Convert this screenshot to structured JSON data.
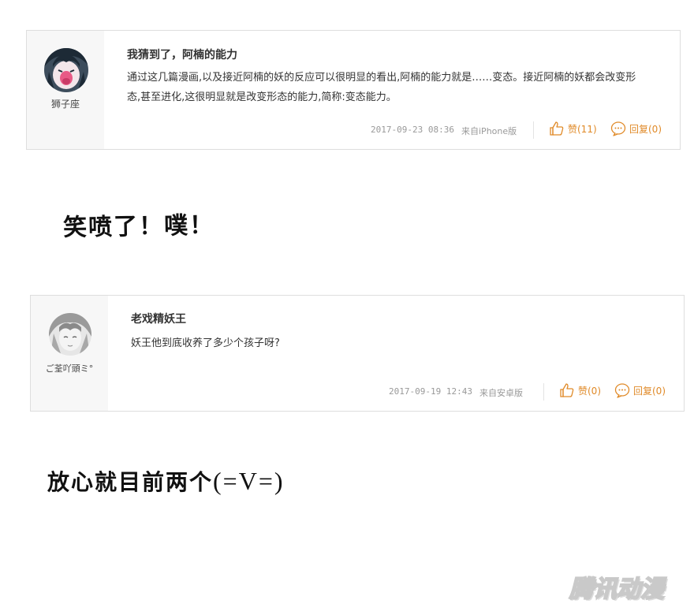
{
  "comments": [
    {
      "username": "狮子座",
      "title": "我猜到了，阿楠的能力",
      "body": "通过这几篇漫画,以及接近阿楠的妖的反应可以很明显的看出,阿楠的能力就是……变态。接近阿楠的妖都会改变形态,甚至进化,这很明显就是改变形态的能力,简称:变态能力。",
      "date": "2017-09-23 08:36",
      "source": "来自iPhone版",
      "like_label": "赞(11)",
      "reply_label": "回复(0)",
      "avatar_icon": "anime-avatar-icon"
    },
    {
      "username": "ご荃吖頭ミ°",
      "title": "老戏精妖王",
      "body": "妖王他到底收养了多少个孩子呀?",
      "date": "2017-09-19 12:43",
      "source": "来自安卓版",
      "like_label": "赞(0)",
      "reply_label": "回复(0)",
      "avatar_icon": "sketch-avatar-icon"
    }
  ],
  "captions": {
    "first": "笑喷了！噗！",
    "second_text": "放心就目前两个",
    "second_emote": "(=V=)"
  },
  "watermark": "腾讯动漫",
  "colors": {
    "accent": "#e08a28",
    "meta": "#999999",
    "border": "#dedede",
    "user_panel": "#f7f7f7"
  }
}
